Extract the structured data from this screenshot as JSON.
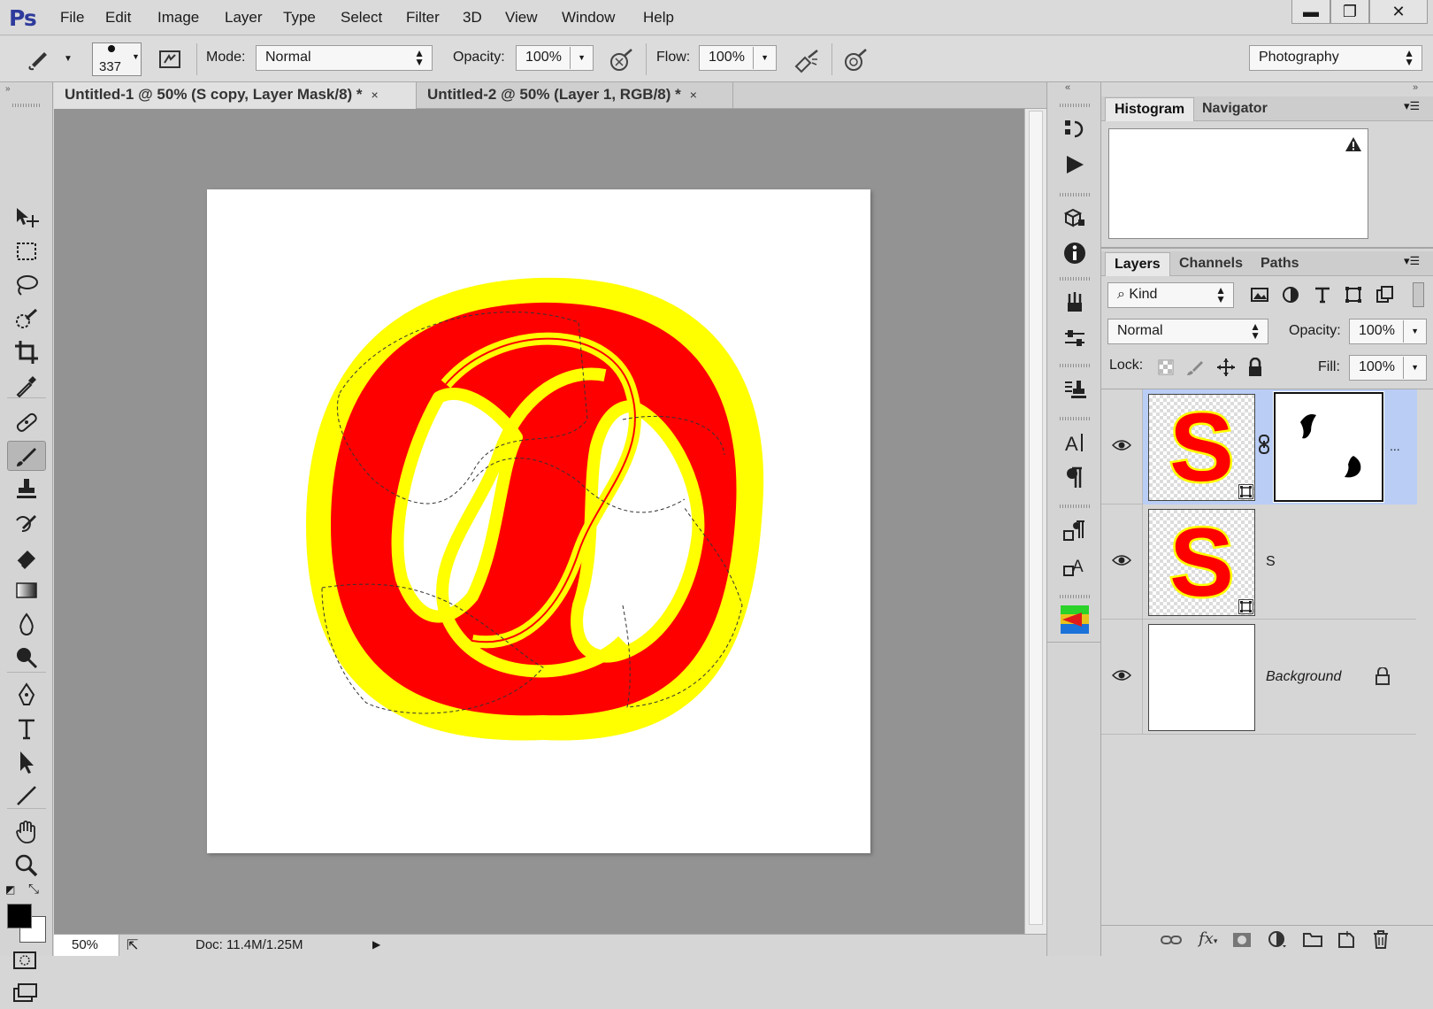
{
  "app": {
    "logo": "Ps",
    "menu": [
      "File",
      "Edit",
      "Image",
      "Layer",
      "Type",
      "Select",
      "Filter",
      "3D",
      "View",
      "Window",
      "Help"
    ]
  },
  "window_controls": {
    "minimize": "▬",
    "restore": "❐",
    "close": "✕"
  },
  "options_bar": {
    "brush_size": "337",
    "mode_label": "Mode:",
    "mode_value": "Normal",
    "opacity_label": "Opacity:",
    "opacity_value": "100%",
    "flow_label": "Flow:",
    "flow_value": "100%",
    "workspace": "Photography"
  },
  "tabs": [
    {
      "label": "Untitled-1 @ 50% (S copy, Layer Mask/8) *",
      "active": true
    },
    {
      "label": "Untitled-2 @ 50% (Layer 1, RGB/8) *",
      "active": false
    }
  ],
  "tab_close": "×",
  "colors": {
    "foreground": "#000000",
    "background": "#ffffff",
    "shape_fill": "#ff0000",
    "shape_stroke": "#ffff00",
    "layer_selected": "#b9cdf5"
  },
  "status": {
    "zoom": "50%",
    "doc": "Doc: 11.4M/1.25M"
  },
  "histogram_panel": {
    "tabs": [
      "Histogram",
      "Navigator"
    ]
  },
  "layers_panel": {
    "tabs": [
      "Layers",
      "Channels",
      "Paths"
    ],
    "kind_label": "Kind",
    "blend_mode": "Normal",
    "opacity_label": "Opacity:",
    "opacity_value": "100%",
    "lock_label": "Lock:",
    "fill_label": "Fill:",
    "fill_value": "100%",
    "layers": [
      {
        "name": "",
        "selected": true,
        "has_mask": true
      },
      {
        "name": "S",
        "selected": false
      },
      {
        "name": "Background",
        "selected": false,
        "locked": true
      }
    ],
    "more_indicator": "..."
  }
}
